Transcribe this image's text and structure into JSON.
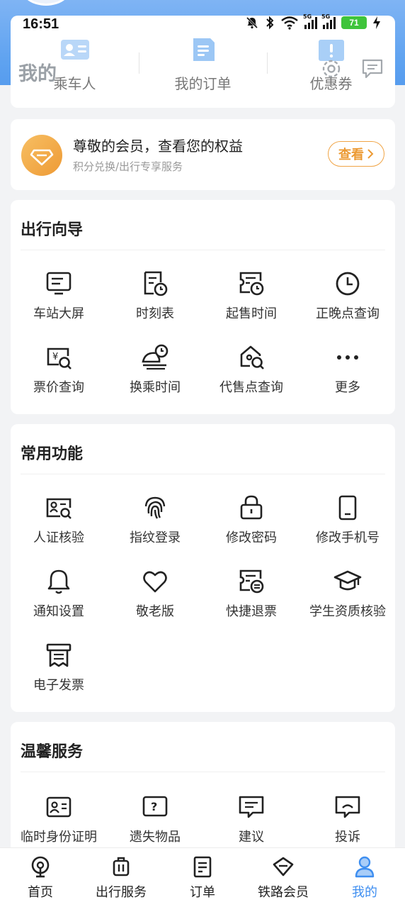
{
  "status_bar": {
    "time": "16:51",
    "network_1": "5G",
    "network_2": "5G",
    "battery": "71",
    "icons": [
      "mute-icon",
      "bluetooth-icon",
      "wifi-icon",
      "signal-icon",
      "signal-icon",
      "battery-icon",
      "charging-icon"
    ]
  },
  "header": {
    "title": "我的",
    "settings_icon": "gear-icon",
    "message_icon": "message-icon"
  },
  "top_tabs": [
    {
      "label": "乘车人",
      "icon": "passenger-card-icon"
    },
    {
      "label": "我的订单",
      "icon": "order-doc-icon"
    },
    {
      "label": "优惠券",
      "icon": "coupon-icon"
    }
  ],
  "member": {
    "title": "尊敬的会员，查看您的权益",
    "subtitle": "积分兑换/出行专享服务",
    "button": "查看",
    "accent": "#ee9a35"
  },
  "sections": {
    "travel_guide": {
      "title": "出行向导",
      "items": [
        {
          "label": "车站大屏",
          "icon": "station-screen-icon"
        },
        {
          "label": "时刻表",
          "icon": "timetable-icon"
        },
        {
          "label": "起售时间",
          "icon": "sale-time-icon"
        },
        {
          "label": "正晚点查询",
          "icon": "clock-icon"
        },
        {
          "label": "票价查询",
          "icon": "fare-search-icon"
        },
        {
          "label": "换乘时间",
          "icon": "transfer-time-icon"
        },
        {
          "label": "代售点查询",
          "icon": "agency-search-icon"
        },
        {
          "label": "更多",
          "icon": "more-dots-icon"
        }
      ]
    },
    "common_functions": {
      "title": "常用功能",
      "items": [
        {
          "label": "人证核验",
          "icon": "id-verify-icon"
        },
        {
          "label": "指纹登录",
          "icon": "fingerprint-icon"
        },
        {
          "label": "修改密码",
          "icon": "lock-icon"
        },
        {
          "label": "修改手机号",
          "icon": "phone-icon"
        },
        {
          "label": "通知设置",
          "icon": "bell-icon"
        },
        {
          "label": "敬老版",
          "icon": "heart-icon"
        },
        {
          "label": "快捷退票",
          "icon": "refund-ticket-icon"
        },
        {
          "label": "学生资质核验",
          "icon": "graduation-cap-icon"
        },
        {
          "label": "电子发票",
          "icon": "invoice-icon"
        }
      ]
    },
    "warm_services": {
      "title": "温馨服务",
      "items": [
        {
          "label": "临时身份证明",
          "icon": "temp-id-icon"
        },
        {
          "label": "遗失物品",
          "icon": "lost-item-icon"
        },
        {
          "label": "建议",
          "icon": "suggestion-icon"
        },
        {
          "label": "投诉",
          "icon": "complaint-icon"
        }
      ]
    }
  },
  "bottom_nav": [
    {
      "label": "首页",
      "icon": "home-train-icon"
    },
    {
      "label": "出行服务",
      "icon": "luggage-icon"
    },
    {
      "label": "订单",
      "icon": "order-icon"
    },
    {
      "label": "铁路会员",
      "icon": "diamond-icon"
    },
    {
      "label": "我的",
      "icon": "user-icon",
      "active": true
    }
  ],
  "colors": {
    "primary": "#3e8ef0",
    "header_blue": "#5ea2f0",
    "member_orange": "#ee9a35"
  }
}
